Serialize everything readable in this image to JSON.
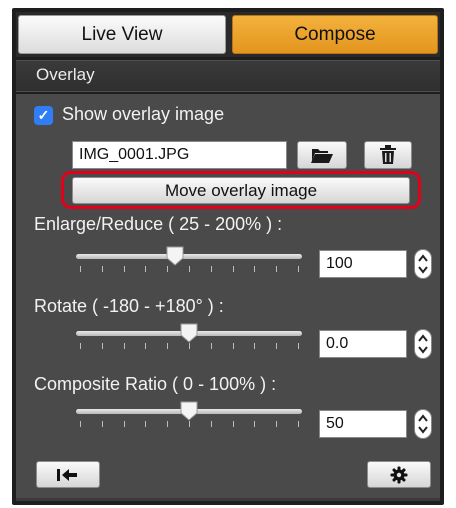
{
  "tabs": {
    "live_view": "Live View",
    "compose": "Compose"
  },
  "section_title": "Overlay",
  "show_overlay": {
    "label": "Show overlay image",
    "checked": true
  },
  "file": {
    "value": "IMG_0001.JPG"
  },
  "move_button": "Move overlay image",
  "enlarge": {
    "label": "Enlarge/Reduce ( 25 - 200% ) :",
    "value": "100",
    "fraction": 0.44
  },
  "rotate": {
    "label": "Rotate ( -180 - +180° ) :",
    "value": "0.0",
    "fraction": 0.5
  },
  "composite": {
    "label": "Composite Ratio ( 0 - 100% ) :",
    "value": "50",
    "fraction": 0.5
  },
  "colors": {
    "accent_tab": "#e9a02a",
    "checkbox": "#2f7ef6",
    "highlight": "#e3001b"
  },
  "icons": {
    "browse": "folder-open-icon",
    "delete": "trash-icon",
    "reset": "reset-arrow-icon",
    "settings": "gear-icon"
  }
}
